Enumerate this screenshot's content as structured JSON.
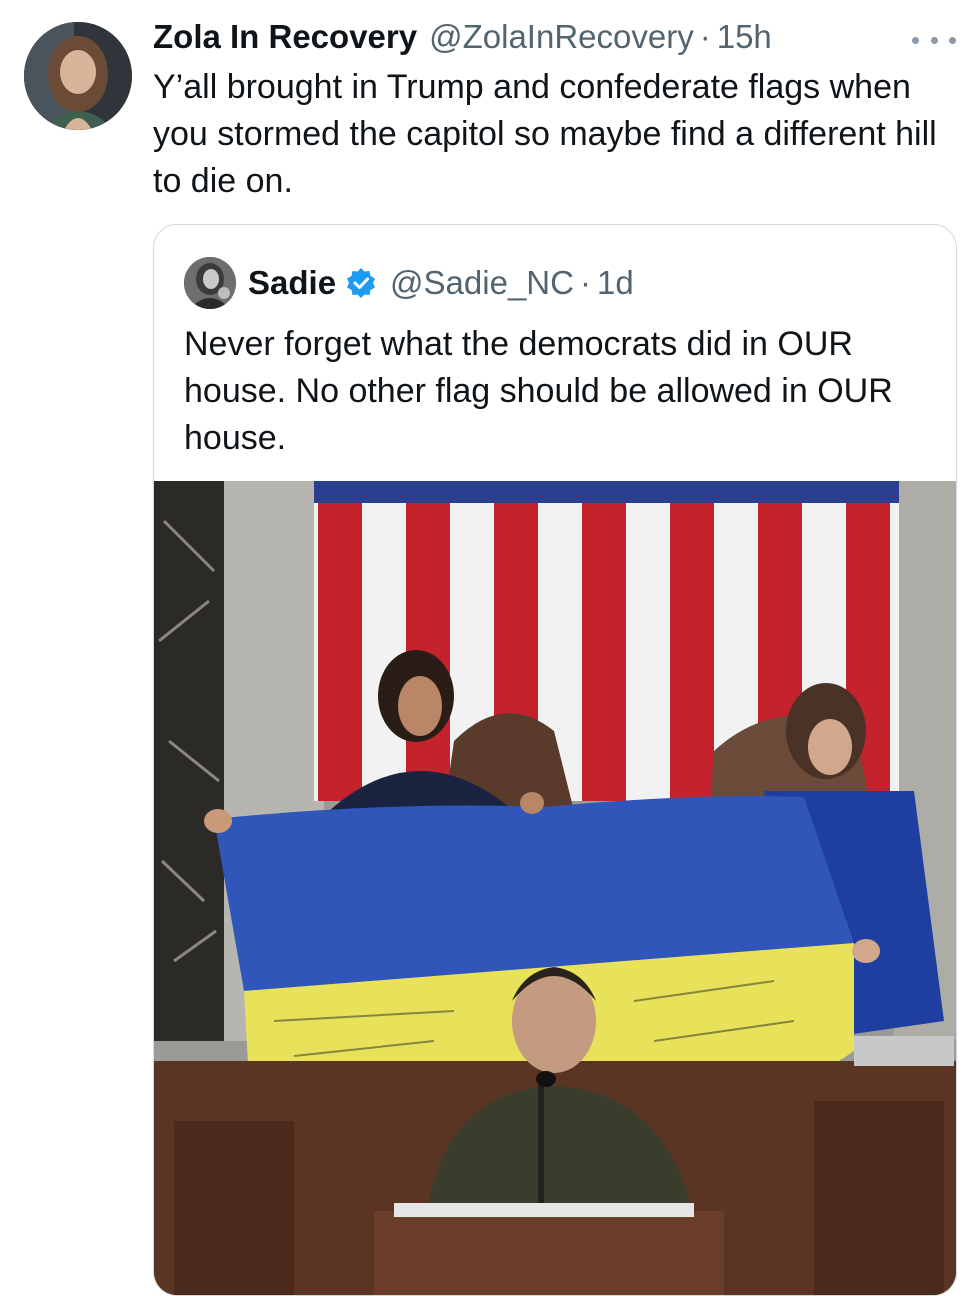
{
  "tweet": {
    "author": {
      "display_name": "Zola In Recovery",
      "handle": "@ZolaInRecovery",
      "time": "15h"
    },
    "separator": "·",
    "text": "Y’all brought in Trump and confederate flags when you stormed the capitol so maybe find a different hill to die on.",
    "more_icon": "more-horizontal-icon"
  },
  "quoted_tweet": {
    "author": {
      "display_name": "Sadie",
      "handle": "@Sadie_NC",
      "time": "1d",
      "verified": true
    },
    "separator": "·",
    "text": "Never forget what the democrats did in OUR house. No other flag should be allowed in OUR house.",
    "media": {
      "type": "photo"
    }
  },
  "colors": {
    "text_primary": "#0f1419",
    "text_secondary": "#536471",
    "border": "#cfd9de",
    "verified_blue": "#1d9bf0",
    "flag_blue": "#2f56b8",
    "flag_yellow": "#e8e25a",
    "us_red": "#c4222d"
  }
}
